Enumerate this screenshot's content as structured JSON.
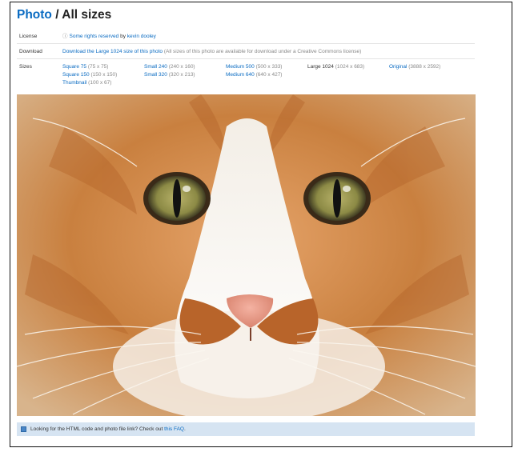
{
  "header": {
    "photo_link": "Photo",
    "separator": " / ",
    "title": "All sizes"
  },
  "license": {
    "label": "License",
    "icon": "cc-icon",
    "link": "Some rights reserved",
    "by_text": " by ",
    "author": "kevin dooley"
  },
  "download": {
    "label": "Download",
    "link": "Download the Large 1024 size of this photo",
    "note": " (All sizes of this photo are available for download under a Creative Commons license)"
  },
  "sizes": {
    "label": "Sizes",
    "items": [
      {
        "name": "Square 75",
        "dims": "(75 x 75)"
      },
      {
        "name": "Square 150",
        "dims": "(150 x 150)"
      },
      {
        "name": "Thumbnail",
        "dims": "(100 x 67)"
      },
      {
        "name": "Small 240",
        "dims": "(240 x 160)"
      },
      {
        "name": "Small 320",
        "dims": "(320 x 213)"
      },
      {
        "name": "Medium 500",
        "dims": "(500 x 333)"
      },
      {
        "name": "Medium 640",
        "dims": "(640 x 427)"
      },
      {
        "name": "Large 1024",
        "dims": "(1024 x 683)"
      },
      {
        "name": "Original",
        "dims": "(3888 x 2592)"
      }
    ]
  },
  "faq": {
    "icon": "info-icon",
    "text": "Looking for the HTML code and photo file link? Check out ",
    "link": "this FAQ",
    "end": "."
  },
  "colors": {
    "link": "#0a6bc2",
    "faq_bar": "#d6e4f2"
  }
}
